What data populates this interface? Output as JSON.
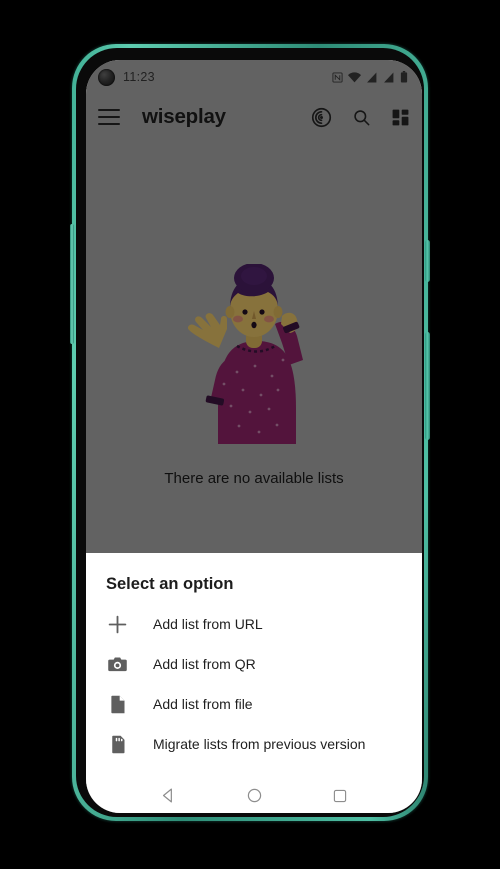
{
  "device": {
    "frame_color": "#3fae94",
    "screen_bg": "#ffffff"
  },
  "status_bar": {
    "time": "11:23",
    "icons": [
      "nfc-icon",
      "wifi-icon",
      "signal-icon",
      "signal-2-icon",
      "battery-icon"
    ]
  },
  "toolbar": {
    "menu_icon": "hamburger-menu-icon",
    "title": "wiseplay",
    "actions": [
      {
        "name": "cast-icon",
        "label": "Cast"
      },
      {
        "name": "search-icon",
        "label": "Search"
      },
      {
        "name": "grid-view-icon",
        "label": "Grid view"
      }
    ]
  },
  "empty_state": {
    "illustration": "confused-woman-illustration",
    "message": "There are no available lists",
    "colors": {
      "hair": "#4a1f63",
      "sweater": "#a02a77",
      "skin": "#e8c468",
      "cheek": "#e07a7a"
    }
  },
  "bottom_sheet": {
    "title": "Select an option",
    "items": [
      {
        "icon": "plus-icon",
        "label": "Add list from URL"
      },
      {
        "icon": "camera-icon",
        "label": "Add list from QR"
      },
      {
        "icon": "file-icon",
        "label": "Add list from file"
      },
      {
        "icon": "sd-card-icon",
        "label": "Migrate lists from previous version"
      }
    ]
  },
  "nav_bar": {
    "buttons": [
      {
        "name": "back-button",
        "icon": "triangle-left-icon"
      },
      {
        "name": "home-button",
        "icon": "circle-icon"
      },
      {
        "name": "recents-button",
        "icon": "square-icon"
      }
    ]
  }
}
